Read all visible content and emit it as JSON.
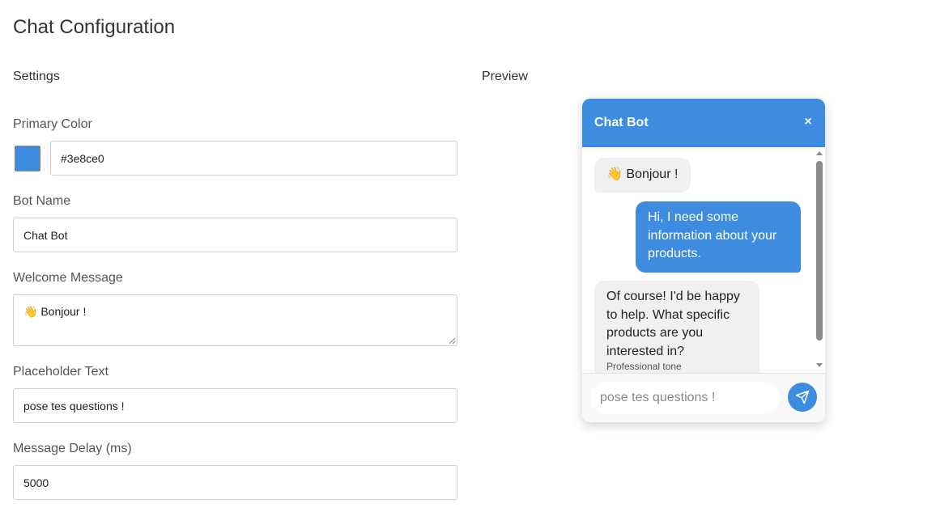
{
  "page": {
    "title": "Chat Configuration",
    "settings_title": "Settings",
    "preview_title": "Preview"
  },
  "form": {
    "primary_color_label": "Primary Color",
    "primary_color_value": "#3e8ce0",
    "bot_name_label": "Bot Name",
    "bot_name_value": "Chat Bot",
    "welcome_label": "Welcome Message",
    "welcome_value": "👋 Bonjour !",
    "placeholder_label": "Placeholder Text",
    "placeholder_value": "pose tes questions !",
    "delay_label": "Message Delay (ms)",
    "delay_value": "5000"
  },
  "chat": {
    "header_title": "Chat Bot",
    "close_icon": "×",
    "accent_color": "#3e8ce0",
    "messages": [
      {
        "role": "bot",
        "text": "👋 Bonjour !"
      },
      {
        "role": "user",
        "text": "Hi, I need some information about your products."
      },
      {
        "role": "bot",
        "text": "Of course! I'd be happy to help. What specific products are you interested in?",
        "meta": "Professional tone"
      }
    ],
    "input_placeholder": "pose tes questions !",
    "send_icon": "send-icon"
  }
}
